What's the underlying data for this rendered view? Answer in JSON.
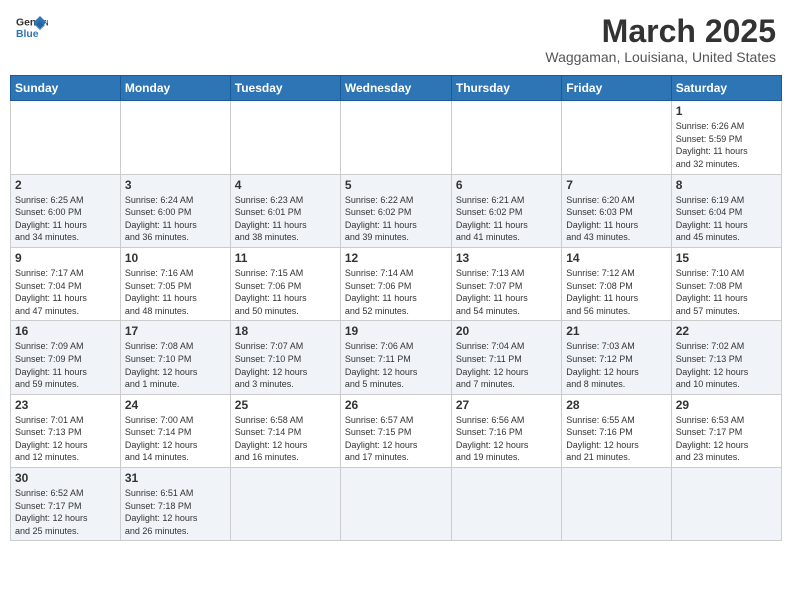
{
  "header": {
    "logo_general": "General",
    "logo_blue": "Blue",
    "month_title": "March 2025",
    "location": "Waggaman, Louisiana, United States"
  },
  "weekdays": [
    "Sunday",
    "Monday",
    "Tuesday",
    "Wednesday",
    "Thursday",
    "Friday",
    "Saturday"
  ],
  "rows": [
    [
      {
        "day": "",
        "info": ""
      },
      {
        "day": "",
        "info": ""
      },
      {
        "day": "",
        "info": ""
      },
      {
        "day": "",
        "info": ""
      },
      {
        "day": "",
        "info": ""
      },
      {
        "day": "",
        "info": ""
      },
      {
        "day": "1",
        "info": "Sunrise: 6:26 AM\nSunset: 5:59 PM\nDaylight: 11 hours\nand 32 minutes."
      }
    ],
    [
      {
        "day": "2",
        "info": "Sunrise: 6:25 AM\nSunset: 6:00 PM\nDaylight: 11 hours\nand 34 minutes."
      },
      {
        "day": "3",
        "info": "Sunrise: 6:24 AM\nSunset: 6:00 PM\nDaylight: 11 hours\nand 36 minutes."
      },
      {
        "day": "4",
        "info": "Sunrise: 6:23 AM\nSunset: 6:01 PM\nDaylight: 11 hours\nand 38 minutes."
      },
      {
        "day": "5",
        "info": "Sunrise: 6:22 AM\nSunset: 6:02 PM\nDaylight: 11 hours\nand 39 minutes."
      },
      {
        "day": "6",
        "info": "Sunrise: 6:21 AM\nSunset: 6:02 PM\nDaylight: 11 hours\nand 41 minutes."
      },
      {
        "day": "7",
        "info": "Sunrise: 6:20 AM\nSunset: 6:03 PM\nDaylight: 11 hours\nand 43 minutes."
      },
      {
        "day": "8",
        "info": "Sunrise: 6:19 AM\nSunset: 6:04 PM\nDaylight: 11 hours\nand 45 minutes."
      }
    ],
    [
      {
        "day": "9",
        "info": "Sunrise: 7:17 AM\nSunset: 7:04 PM\nDaylight: 11 hours\nand 47 minutes."
      },
      {
        "day": "10",
        "info": "Sunrise: 7:16 AM\nSunset: 7:05 PM\nDaylight: 11 hours\nand 48 minutes."
      },
      {
        "day": "11",
        "info": "Sunrise: 7:15 AM\nSunset: 7:06 PM\nDaylight: 11 hours\nand 50 minutes."
      },
      {
        "day": "12",
        "info": "Sunrise: 7:14 AM\nSunset: 7:06 PM\nDaylight: 11 hours\nand 52 minutes."
      },
      {
        "day": "13",
        "info": "Sunrise: 7:13 AM\nSunset: 7:07 PM\nDaylight: 11 hours\nand 54 minutes."
      },
      {
        "day": "14",
        "info": "Sunrise: 7:12 AM\nSunset: 7:08 PM\nDaylight: 11 hours\nand 56 minutes."
      },
      {
        "day": "15",
        "info": "Sunrise: 7:10 AM\nSunset: 7:08 PM\nDaylight: 11 hours\nand 57 minutes."
      }
    ],
    [
      {
        "day": "16",
        "info": "Sunrise: 7:09 AM\nSunset: 7:09 PM\nDaylight: 11 hours\nand 59 minutes."
      },
      {
        "day": "17",
        "info": "Sunrise: 7:08 AM\nSunset: 7:10 PM\nDaylight: 12 hours\nand 1 minute."
      },
      {
        "day": "18",
        "info": "Sunrise: 7:07 AM\nSunset: 7:10 PM\nDaylight: 12 hours\nand 3 minutes."
      },
      {
        "day": "19",
        "info": "Sunrise: 7:06 AM\nSunset: 7:11 PM\nDaylight: 12 hours\nand 5 minutes."
      },
      {
        "day": "20",
        "info": "Sunrise: 7:04 AM\nSunset: 7:11 PM\nDaylight: 12 hours\nand 7 minutes."
      },
      {
        "day": "21",
        "info": "Sunrise: 7:03 AM\nSunset: 7:12 PM\nDaylight: 12 hours\nand 8 minutes."
      },
      {
        "day": "22",
        "info": "Sunrise: 7:02 AM\nSunset: 7:13 PM\nDaylight: 12 hours\nand 10 minutes."
      }
    ],
    [
      {
        "day": "23",
        "info": "Sunrise: 7:01 AM\nSunset: 7:13 PM\nDaylight: 12 hours\nand 12 minutes."
      },
      {
        "day": "24",
        "info": "Sunrise: 7:00 AM\nSunset: 7:14 PM\nDaylight: 12 hours\nand 14 minutes."
      },
      {
        "day": "25",
        "info": "Sunrise: 6:58 AM\nSunset: 7:14 PM\nDaylight: 12 hours\nand 16 minutes."
      },
      {
        "day": "26",
        "info": "Sunrise: 6:57 AM\nSunset: 7:15 PM\nDaylight: 12 hours\nand 17 minutes."
      },
      {
        "day": "27",
        "info": "Sunrise: 6:56 AM\nSunset: 7:16 PM\nDaylight: 12 hours\nand 19 minutes."
      },
      {
        "day": "28",
        "info": "Sunrise: 6:55 AM\nSunset: 7:16 PM\nDaylight: 12 hours\nand 21 minutes."
      },
      {
        "day": "29",
        "info": "Sunrise: 6:53 AM\nSunset: 7:17 PM\nDaylight: 12 hours\nand 23 minutes."
      }
    ],
    [
      {
        "day": "30",
        "info": "Sunrise: 6:52 AM\nSunset: 7:17 PM\nDaylight: 12 hours\nand 25 minutes."
      },
      {
        "day": "31",
        "info": "Sunrise: 6:51 AM\nSunset: 7:18 PM\nDaylight: 12 hours\nand 26 minutes."
      },
      {
        "day": "",
        "info": ""
      },
      {
        "day": "",
        "info": ""
      },
      {
        "day": "",
        "info": ""
      },
      {
        "day": "",
        "info": ""
      },
      {
        "day": "",
        "info": ""
      }
    ]
  ]
}
